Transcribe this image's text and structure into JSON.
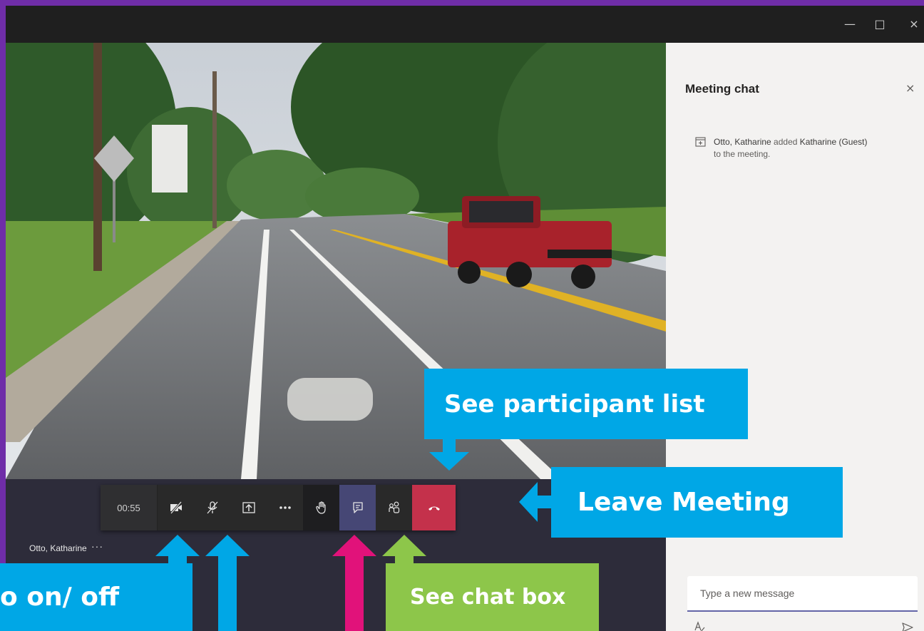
{
  "window": {
    "minimize_icon": "minimize-icon",
    "maximize_icon": "maximize-icon",
    "close_icon": "close-icon"
  },
  "call_controls": {
    "timer": "00:55",
    "buttons": [
      {
        "name": "camera-off-button",
        "icon": "camera-off-icon"
      },
      {
        "name": "mic-off-button",
        "icon": "mic-off-icon"
      },
      {
        "name": "share-screen-button",
        "icon": "share-screen-icon"
      },
      {
        "name": "more-actions-button",
        "icon": "more-icon"
      },
      {
        "name": "raise-hand-button",
        "icon": "hand-icon"
      },
      {
        "name": "show-chat-button",
        "icon": "chat-icon"
      },
      {
        "name": "show-participants-button",
        "icon": "participants-icon"
      },
      {
        "name": "leave-button",
        "icon": "phone-hangup-icon"
      }
    ]
  },
  "participant": {
    "name": "Otto, Katharine",
    "more": "···"
  },
  "chat_panel": {
    "title": "Meeting chat",
    "close": "×",
    "event": {
      "actor": "Otto, Katharine",
      "verb": " added ",
      "target": "Katharine (Guest)",
      "suffix": " to the meeting."
    },
    "compose_placeholder": "Type a new message"
  },
  "callouts": {
    "participants": "See participant list",
    "leave": "Leave Meeting",
    "chat": "See chat box",
    "video": "o on/ off"
  },
  "colors": {
    "callout_blue": "#00a7e6",
    "callout_green": "#8dc64a",
    "arrow_pink": "#e1127a",
    "leave_red": "#c4314b",
    "chat_active": "#464775",
    "frame_purple": "#6f2da8"
  }
}
